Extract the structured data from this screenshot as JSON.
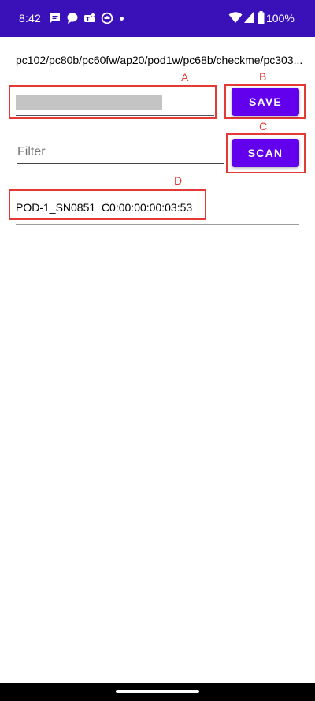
{
  "status_bar": {
    "time": "8:42",
    "battery_percent": "100%",
    "background": "#3a11b8",
    "notification_icons": [
      "chat-icon",
      "message-bubble-icon",
      "teams-icon",
      "app-circle-icon"
    ],
    "system_icons": [
      "wifi-icon",
      "cell-signal-icon",
      "battery-icon"
    ]
  },
  "header": {
    "device_types": "pc102/pc80b/pc60fw/ap20/pod1w/pc68b/checkme/pc303..."
  },
  "name_field": {
    "redacted": true
  },
  "buttons": {
    "save_label": "SAVE",
    "scan_label": "SCAN",
    "color": "#6200ee"
  },
  "filter": {
    "placeholder": "Filter",
    "value": ""
  },
  "devices": [
    {
      "label": "POD-1_SN0851  C0:00:00:00:03:53"
    }
  ],
  "annotations": {
    "labels": [
      "A",
      "B",
      "C",
      "D"
    ],
    "color": "#e53935"
  }
}
